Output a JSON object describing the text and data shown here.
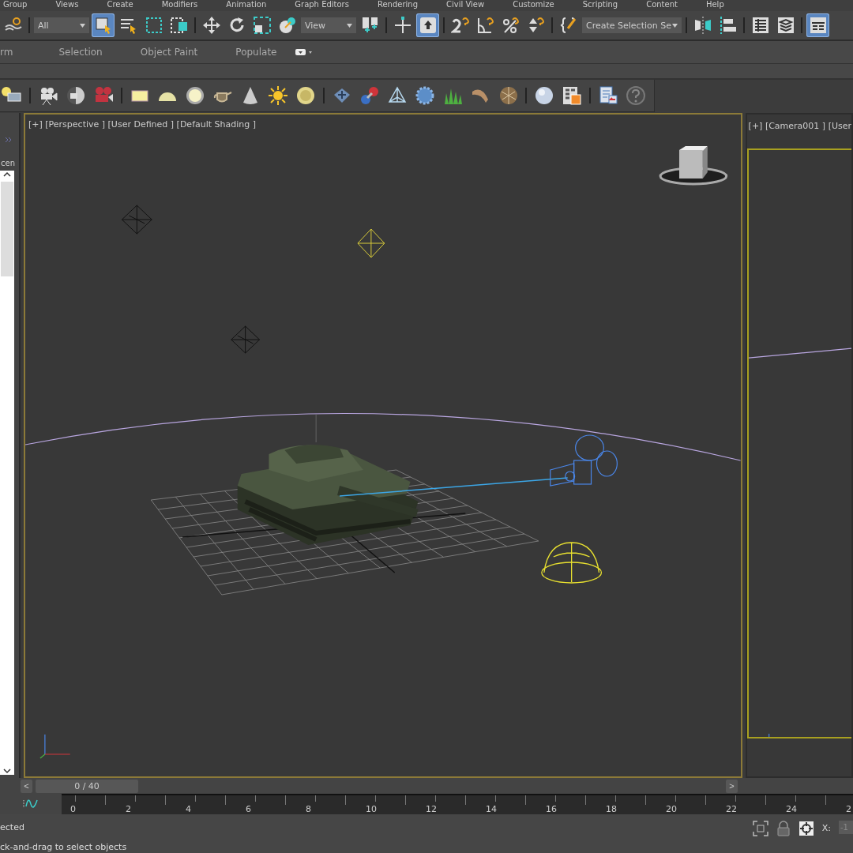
{
  "menu": [
    "Group",
    "Views",
    "Create",
    "Modifiers",
    "Animation",
    "Graph Editors",
    "Rendering",
    "Civil View",
    "Customize",
    "Scripting",
    "Content",
    "Help"
  ],
  "main_toolbar": [
    {
      "kind": "link",
      "selected": false
    },
    {
      "kind": "separator"
    },
    {
      "kind": "dropdown",
      "label": "All"
    },
    {
      "kind": "select",
      "selected": true
    },
    {
      "kind": "select-list",
      "selected": false
    },
    {
      "kind": "region",
      "selected": false
    },
    {
      "kind": "crossing",
      "selected": false
    },
    {
      "kind": "separator"
    },
    {
      "kind": "move",
      "selected": false
    },
    {
      "kind": "rotate",
      "selected": false
    },
    {
      "kind": "scale",
      "selected": false
    },
    {
      "kind": "place",
      "selected": false
    },
    {
      "kind": "dropdown",
      "label": "View"
    },
    {
      "kind": "pivot",
      "selected": false
    },
    {
      "kind": "separator"
    },
    {
      "kind": "axis",
      "selected": false
    },
    {
      "kind": "shortcut",
      "selected": true
    },
    {
      "kind": "separator"
    },
    {
      "kind": "snap",
      "selected": false
    },
    {
      "kind": "angle",
      "selected": false
    },
    {
      "kind": "percent",
      "selected": false
    },
    {
      "kind": "spinner",
      "selected": false
    },
    {
      "kind": "separator"
    },
    {
      "kind": "braces",
      "selected": false
    },
    {
      "kind": "dropdown",
      "label": "Create Selection Se"
    },
    {
      "kind": "separator"
    },
    {
      "kind": "mirror",
      "selected": false
    },
    {
      "kind": "align",
      "selected": false
    },
    {
      "kind": "separator"
    },
    {
      "kind": "table",
      "selected": false
    },
    {
      "kind": "layers",
      "selected": false
    },
    {
      "kind": "separator"
    },
    {
      "kind": "ribbon",
      "selected": true
    }
  ],
  "ribbon_tabs": [
    "rm",
    "Selection",
    "Object Paint",
    "Populate"
  ],
  "secondary_toolbar": [
    {
      "kind": "light-list"
    },
    {
      "kind": "separator"
    },
    {
      "kind": "camera"
    },
    {
      "kind": "camera-half"
    },
    {
      "kind": "movie-camera"
    },
    {
      "kind": "separator"
    },
    {
      "kind": "plane"
    },
    {
      "kind": "dome"
    },
    {
      "kind": "glow"
    },
    {
      "kind": "teapot"
    },
    {
      "kind": "cone"
    },
    {
      "kind": "sun"
    },
    {
      "kind": "sphere"
    },
    {
      "kind": "separator"
    },
    {
      "kind": "dots"
    },
    {
      "kind": "molecule"
    },
    {
      "kind": "pyramid"
    },
    {
      "kind": "gear"
    },
    {
      "kind": "grass"
    },
    {
      "kind": "hair"
    },
    {
      "kind": "ball"
    },
    {
      "kind": "separator"
    },
    {
      "kind": "material"
    },
    {
      "kind": "editor"
    },
    {
      "kind": "separator"
    },
    {
      "kind": "document"
    },
    {
      "kind": "help"
    }
  ],
  "left_panel": {
    "label": "cen"
  },
  "viewports": [
    {
      "label": "[+] [Perspective ] [User Defined ] [Default Shading ]",
      "active": true
    },
    {
      "label": "[+] [Camera001 ] [User",
      "active": false
    }
  ],
  "time_slider": {
    "prev": "<",
    "frame": "0 / 40",
    "next": ">",
    "level": 0
  },
  "track_bar": {
    "labels": [
      "0",
      "2",
      "4",
      "6",
      "8",
      "10",
      "12",
      "14",
      "16",
      "18",
      "20",
      "22",
      "24",
      "2"
    ]
  },
  "status_bar": {
    "selection": "ected",
    "prompt": "ck-and-drag to select objects",
    "x_label": "X:",
    "x_value": "-1"
  }
}
